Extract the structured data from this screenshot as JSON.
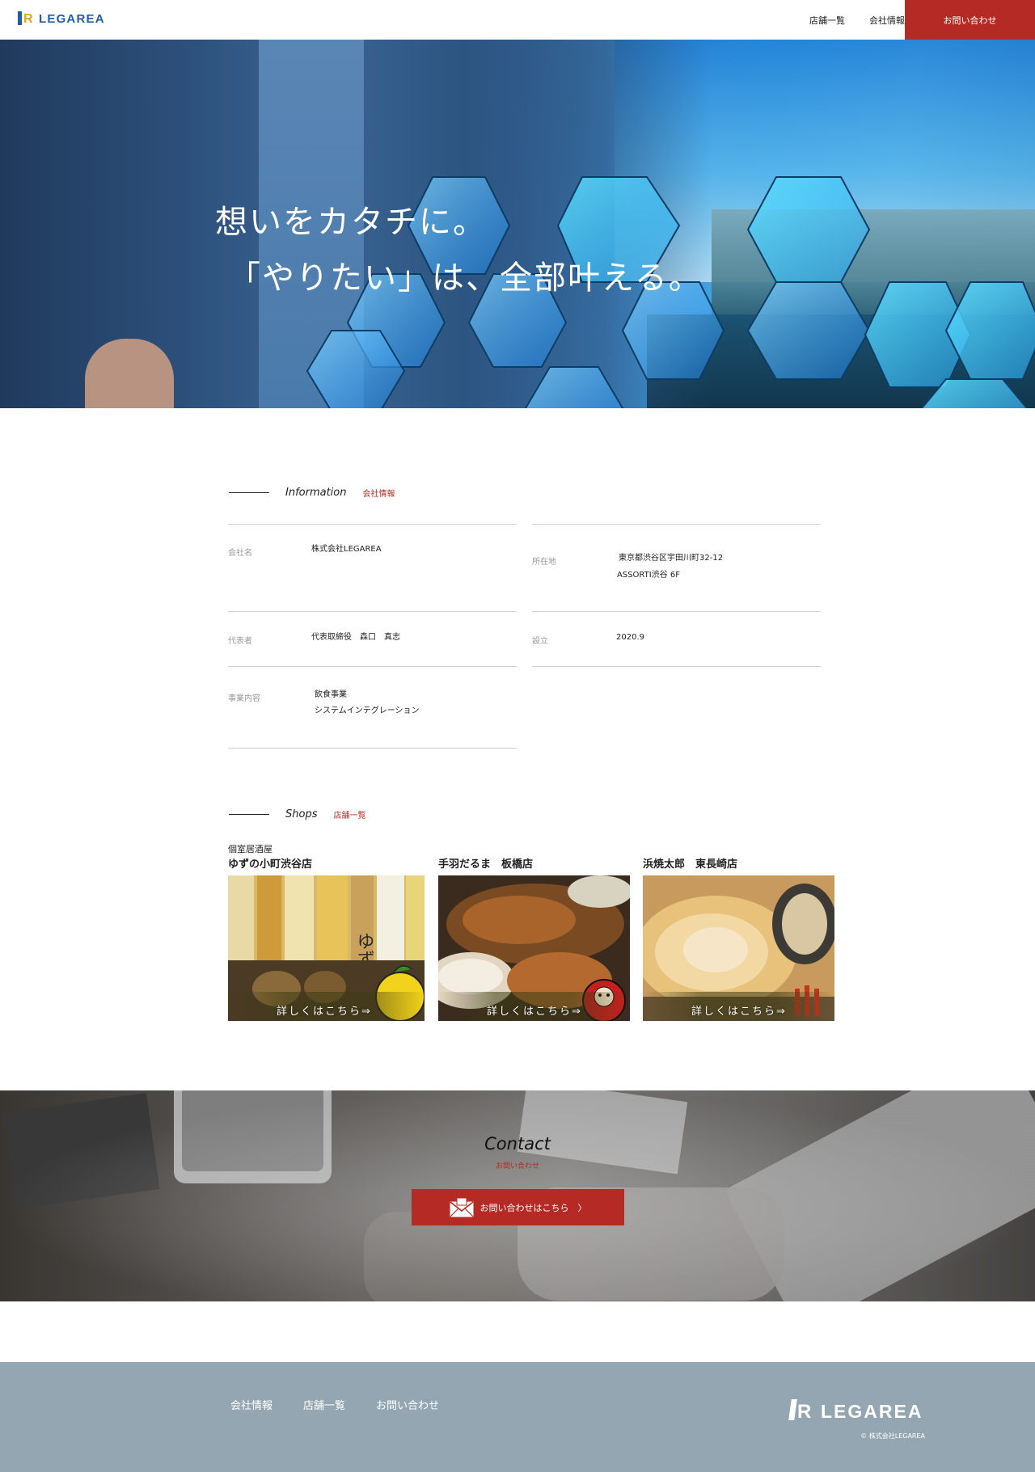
{
  "header": {
    "logo_text": "LEGAREA",
    "logo_mark_letter": "R",
    "nav": [
      "店舗一覧",
      "会社情報"
    ],
    "contact_label": "お問い合わせ"
  },
  "hero": {
    "line1": "想いをカタチに。",
    "line2": "「やりたい」は、全部叶える。"
  },
  "info": {
    "heading_en": "Information",
    "heading_jp": "会社情報",
    "rows": [
      {
        "label": "会社名",
        "value_lines": [
          "株式会社LEGAREA"
        ]
      },
      {
        "label": "所在地",
        "value_lines": [
          "東京都渋谷区宇田川町32-12",
          "ASSORTI渋谷 6F"
        ]
      },
      {
        "label": "代表者",
        "value_lines": [
          "代表取締役　森口　真志"
        ]
      },
      {
        "label": "設立",
        "value_lines": [
          "2020.9"
        ]
      },
      {
        "label": "事業内容",
        "value_lines": [
          "飲食事業",
          "システムインテグレーション"
        ]
      }
    ]
  },
  "shops": {
    "heading_en": "Shops",
    "heading_jp": "店舗一覧",
    "more_label": "詳しくはこちら⇒",
    "items": [
      {
        "sub": "個室居酒屋",
        "name": "ゆずの小町渋谷店",
        "photo_icon": "yuzu-bottles-photo"
      },
      {
        "sub": "",
        "name": "手羽だるま　板橋店",
        "photo_icon": "chicken-wings-photo"
      },
      {
        "sub": "",
        "name": "浜焼太郎　東長崎店",
        "photo_icon": "grilled-scallop-photo"
      }
    ]
  },
  "contact": {
    "title": "Contact",
    "subtitle": "お問い合わせ",
    "button_label": "お問い合わせはこちら　〉"
  },
  "footer": {
    "nav": [
      "会社情報",
      "店舗一覧",
      "お問い合わせ"
    ],
    "logo_text": "LEGAREA",
    "logo_mark_letter": "R",
    "copyright": "© 株式会社LEGAREA"
  },
  "colors": {
    "accent": "#b52a25",
    "brand_blue": "#1d5fae",
    "footer_bg": "#93a6b2"
  }
}
